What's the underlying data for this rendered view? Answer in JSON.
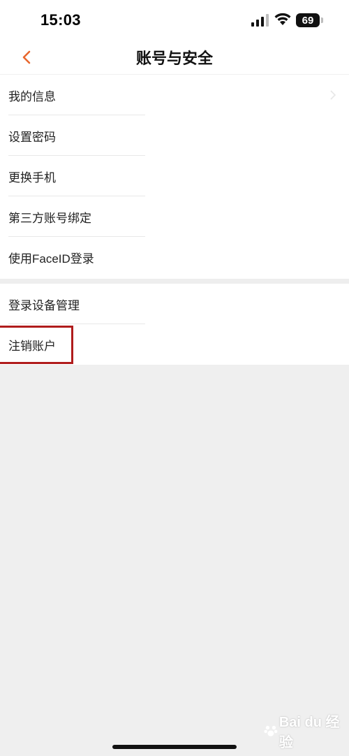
{
  "status_bar": {
    "time": "15:03",
    "battery_level": "69",
    "icons": [
      "signal-icon",
      "wifi-icon",
      "battery-icon"
    ]
  },
  "nav": {
    "title": "账号与安全",
    "back_icon": "chevron-left-icon"
  },
  "groups": [
    {
      "items": [
        {
          "label": "我的信息"
        },
        {
          "label": "设置密码"
        },
        {
          "label": "更换手机"
        },
        {
          "label": "第三方账号绑定"
        },
        {
          "label": "使用FaceID登录"
        }
      ]
    },
    {
      "items": [
        {
          "label": "登录设备管理"
        },
        {
          "label": "注销账户"
        }
      ]
    }
  ],
  "highlighted_item": "注销账户",
  "watermark": "Bai du 经验",
  "colors": {
    "accent": "#e8672e",
    "highlight_box": "#b01c1c",
    "background": "#efefef"
  }
}
